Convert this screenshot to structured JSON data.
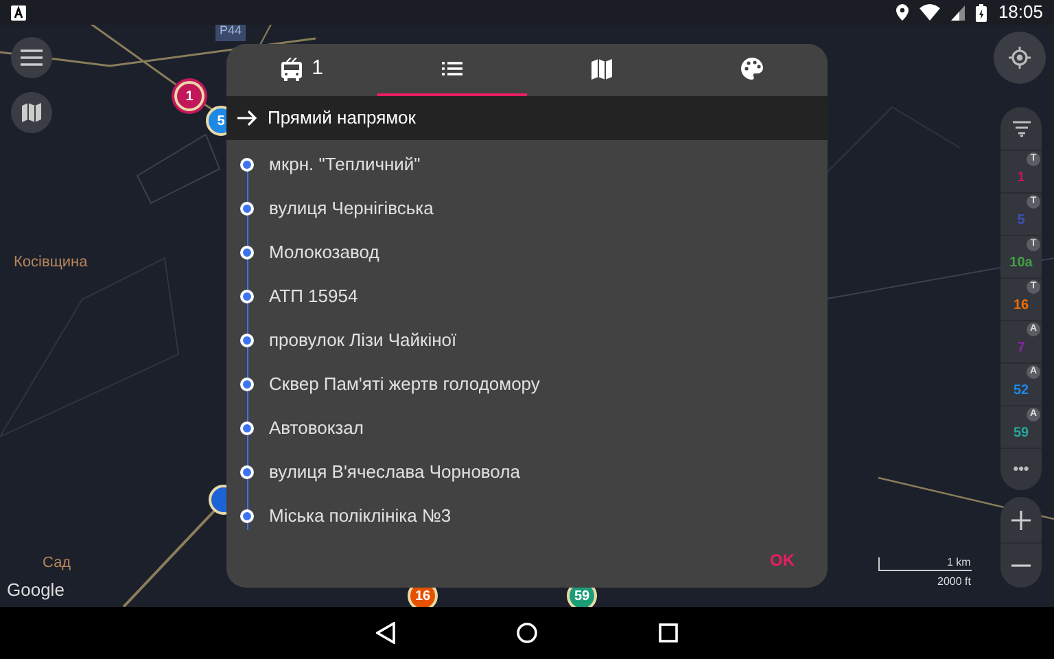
{
  "status_bar": {
    "time": "18:05"
  },
  "map": {
    "labels": [
      {
        "kind": "road",
        "text": "P44"
      },
      {
        "kind": "place",
        "text": "Косівщина"
      },
      {
        "kind": "place",
        "text": "Сад"
      }
    ],
    "markers": [
      {
        "label": "1",
        "color": "#c2185b",
        "selected": true
      },
      {
        "label": "5",
        "color": "#1e88e5",
        "selected": false
      },
      {
        "color": "#1e63d6",
        "selected": false
      },
      {
        "label": "16",
        "color": "#e65100",
        "selected": false
      },
      {
        "label": "59",
        "color": "#1b9e77",
        "selected": false
      }
    ],
    "attribution": "Google",
    "scale": {
      "metric": "1 km",
      "imperial": "2000 ft"
    }
  },
  "route_filter": {
    "routes": [
      {
        "number": "1",
        "type": "T",
        "color": "#c2185b"
      },
      {
        "number": "5",
        "type": "T",
        "color": "#3f51b5"
      },
      {
        "number": "10a",
        "type": "T",
        "color": "#43a047"
      },
      {
        "number": "16",
        "type": "T",
        "color": "#ef6c00"
      },
      {
        "number": "7",
        "type": "A",
        "color": "#8e24aa"
      },
      {
        "number": "52",
        "type": "A",
        "color": "#1e88e5"
      },
      {
        "number": "59",
        "type": "A",
        "color": "#26a69a"
      }
    ],
    "more": "•••"
  },
  "dialog": {
    "tabs": [
      {
        "kind": "vehicle",
        "label": "1",
        "selected": false
      },
      {
        "kind": "list",
        "selected": true
      },
      {
        "kind": "map",
        "selected": false
      },
      {
        "kind": "palette",
        "selected": false
      }
    ],
    "direction": "Прямий напрямок",
    "stops": [
      "мкрн. \"Тепличний\"",
      "вулиця Чернігівська",
      "Молокозавод",
      "АТП 15954",
      "провулок Лізи Чайкіної",
      "Сквер Пам'яті жертв голодомору",
      "Автовокзал",
      "вулиця В'ячеслава Чорновола",
      "Міська поліклініка №3"
    ],
    "ok_button": "OK"
  }
}
